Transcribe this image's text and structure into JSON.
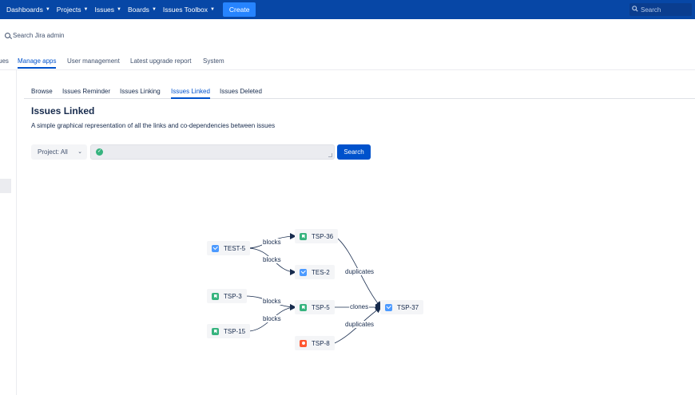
{
  "topnav": {
    "items": [
      {
        "label": "Dashboards"
      },
      {
        "label": "Projects"
      },
      {
        "label": "Issues"
      },
      {
        "label": "Boards"
      },
      {
        "label": "Issues Toolbox"
      }
    ],
    "create_label": "Create",
    "search_placeholder": "Search"
  },
  "admin": {
    "search_label": "Search Jira admin",
    "tabs": [
      "ues",
      "Manage apps",
      "User management",
      "Latest upgrade report",
      "System"
    ]
  },
  "subtabs": [
    "Browse",
    "Issues Reminder",
    "Issues Linking",
    "Issues Linked",
    "Issues Deleted"
  ],
  "page": {
    "title": "Issues Linked",
    "description": "A simple graphical representation of all the links and co-dependencies between issues"
  },
  "filter": {
    "project_label": "Project: All",
    "search_button": "Search"
  },
  "graph": {
    "nodes": [
      {
        "id": "TEST-5",
        "type": "task"
      },
      {
        "id": "TSP-36",
        "type": "story"
      },
      {
        "id": "TES-2",
        "type": "task"
      },
      {
        "id": "TSP-3",
        "type": "story"
      },
      {
        "id": "TSP-5",
        "type": "story"
      },
      {
        "id": "TSP-15",
        "type": "story"
      },
      {
        "id": "TSP-8",
        "type": "bug"
      },
      {
        "id": "TSP-37",
        "type": "task"
      }
    ],
    "edges": [
      {
        "from": "TEST-5",
        "to": "TSP-36",
        "label": "blocks"
      },
      {
        "from": "TEST-5",
        "to": "TES-2",
        "label": "blocks"
      },
      {
        "from": "TSP-3",
        "to": "TSP-5",
        "label": "blocks"
      },
      {
        "from": "TSP-15",
        "to": "TSP-5",
        "label": "blocks"
      },
      {
        "from": "TSP-36",
        "to": "TSP-37",
        "label": "duplicates"
      },
      {
        "from": "TSP-5",
        "to": "TSP-37",
        "label": "clones"
      },
      {
        "from": "TSP-8",
        "to": "TSP-37",
        "label": "duplicates"
      }
    ]
  },
  "colors": {
    "nav_bg": "#0747a6",
    "primary": "#0052cc",
    "create": "#2684ff",
    "story": "#36b37e",
    "task": "#4c9aff",
    "bug": "#ff5630"
  }
}
